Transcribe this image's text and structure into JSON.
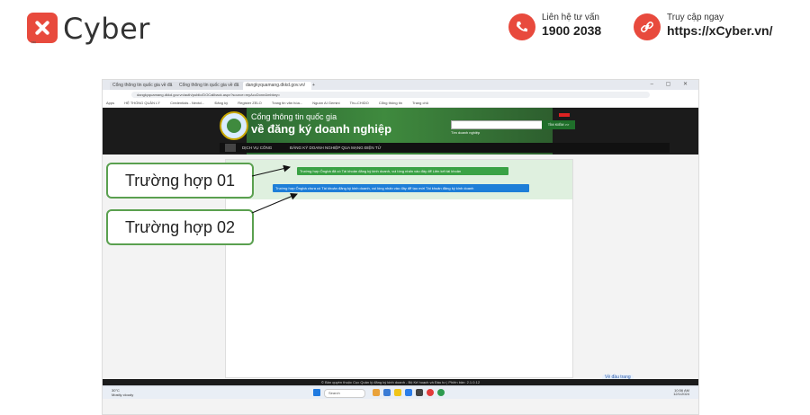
{
  "brand": {
    "name": "Cyber",
    "tm": "™"
  },
  "contact": {
    "phone_label": "Liên hệ tư vấn",
    "phone_value": "1900 2038",
    "web_label": "Truy cập ngay",
    "web_value": "https://xCyber.vn/"
  },
  "browser": {
    "tabs": [
      "Cổng thông tin quốc gia về đă",
      "Cổng thông tin quốc gia về đă",
      "dangkyquamang.dkkd.gov.vn/"
    ],
    "new_tab": "+",
    "window_controls": "– ▢ ✕",
    "address": "dangkyquamang.dkkd.gov.vn/auth/public/DOCallback.aspx?source=myAccDone&mbkey=",
    "bookmarks": [
      "Apps",
      "HỆ THỐNG QUẢN LÝ",
      "Credentials - Nextcl...",
      "Đăng ký",
      "Register ZELO",
      "Trang tin văn hóa...",
      "Nguồn AI Gemini",
      "Thu-CHIDO",
      "Cổng thông tin",
      "Trang chủ"
    ]
  },
  "site": {
    "title_line1": "Cổng thông tin quốc gia",
    "title_line2": "về đăng ký doanh nghiệp",
    "search_button": "TÌM KIẾM >>",
    "search_hint": "Tìm doanh nghiệp",
    "nav": [
      "DỊCH VỤ CÔNG",
      "ĐĂNG KÝ DOANH NGHIỆP QUA MẠNG ĐIỆN TỬ"
    ],
    "msg_case1": "Trường hợp Ôngbà đã có Tài khoản đăng ký kinh doanh, vui lòng nhấn vào đây để Liên kết tài khoản",
    "msg_case2": "Trường hợp Ôngbà chưa có Tài khoản đăng ký kinh doanh, vui lòng nhấn vào đây để tạo mới Tài khoản đăng ký kinh doanh",
    "footer": "© Bản quyền thuộc Cục Quản lý đăng ký kinh doanh - Bộ Kế hoạch và Đầu tư | Phiên bản: 2.1.0.12",
    "zoom_chip": "Về đầu trang"
  },
  "taskbar": {
    "weather_temp": "30°C",
    "weather_desc": "Mostly cloudy",
    "search_placeholder": "Search",
    "time": "10:56 AM",
    "date": "12/1/2024"
  },
  "callouts": {
    "case1": "Trường hợp 01",
    "case2": "Trường hợp 02"
  },
  "colors": {
    "brand_red": "#e84a3d",
    "callout_border": "#5aa04f",
    "msg_green": "#3aa245",
    "msg_blue": "#1e7ed8"
  }
}
